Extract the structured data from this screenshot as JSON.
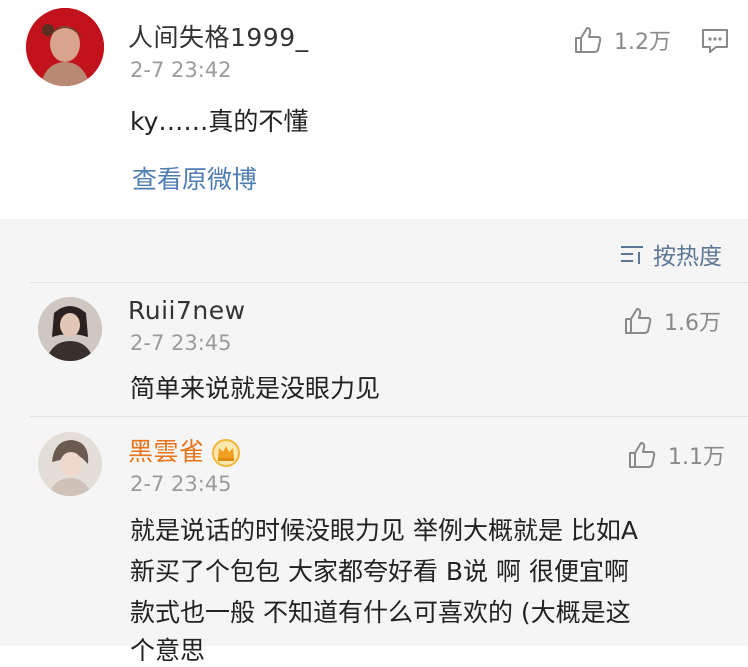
{
  "main_post": {
    "username": "人间失格1999_",
    "timestamp": "2-7 23:42",
    "content": "ky……真的不懂",
    "like_count": "1.2万",
    "view_original_label": "查看原微博"
  },
  "sort": {
    "label": "按热度"
  },
  "comments": [
    {
      "username": "Ruii7new",
      "timestamp": "2-7 23:45",
      "like_count": "1.6万",
      "lines": [
        "简单来说就是没眼力见"
      ]
    },
    {
      "username": "黑雲雀",
      "username_color": "#e8731a",
      "timestamp": "2-7 23:45",
      "like_count": "1.1万",
      "lines": [
        "就是说话的时候没眼力见  举例大概就是 比如A",
        "新买了个包包 大家都夸好看 B说 啊 很便宜啊",
        "款式也一般 不知道有什么可喜欢的 (大概是这",
        "个意思"
      ]
    }
  ],
  "colors": {
    "link_blue": "#4f7db2",
    "muted_gray": "#9b9b9b",
    "comments_bg": "#f5f5f5"
  }
}
